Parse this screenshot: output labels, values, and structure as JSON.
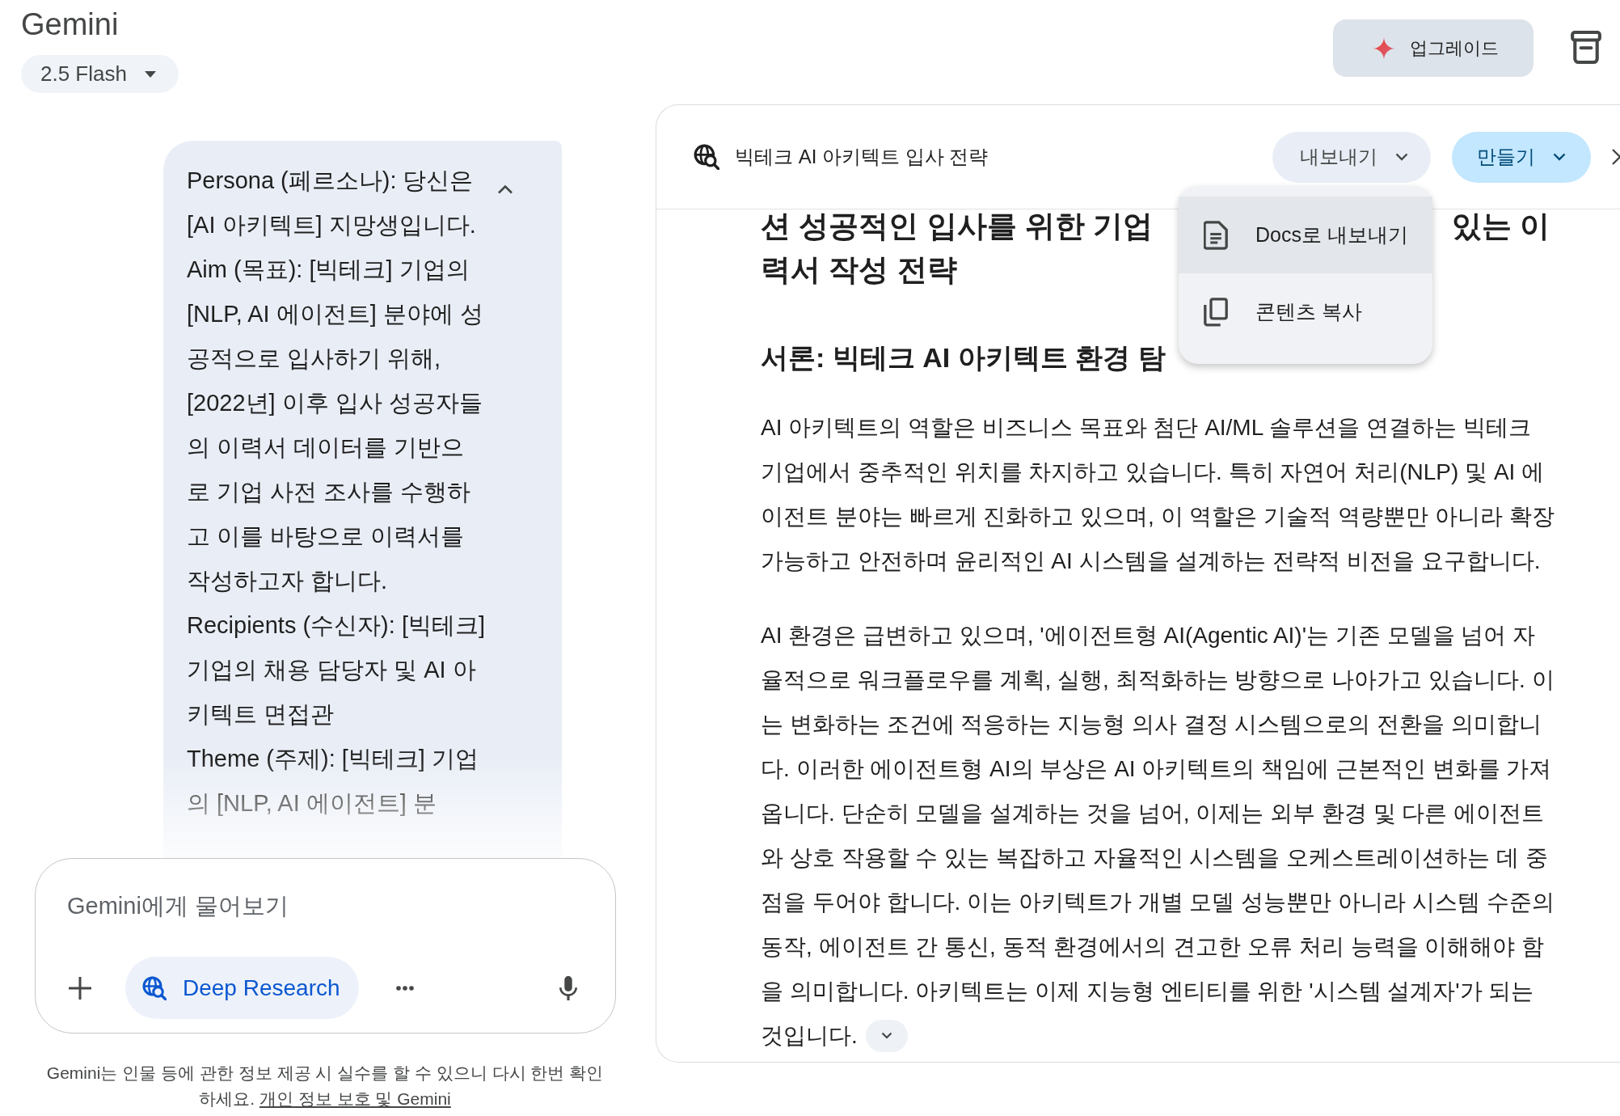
{
  "header": {
    "title": "Gemini",
    "model_picker": {
      "label": "2.5 Flash"
    }
  },
  "top_bar": {
    "upgrade_button": {
      "label": "업그레이드"
    }
  },
  "conversation": {
    "user_message": {
      "expanded": true,
      "paragraphs": [
        "Persona (페르소나): 당신은 [AI 아키텍트] 지망생입니다.",
        "Aim (목표): [빅테크] 기업의 [NLP, AI 에이전트] 분야에 성공적으로 입사하기 위해, [2022년] 이후 입사 성공자들의 이력서 데이터를 기반으로 기업 사전 조사를 수행하고 이를 바탕으로 이력서를 작성하고자 합니다.",
        "Recipients (수신자): [빅테크] 기업의 채용 담당자 및 AI 아키텍트 면접관",
        "Theme (주제): [빅테크] 기업의 [NLP, AI 에이전트] 분"
      ]
    }
  },
  "prompt": {
    "placeholder": "Gemini에게 물어보기",
    "tools": [
      {
        "kind": "add"
      },
      {
        "kind": "chip",
        "label": "Deep Research"
      },
      {
        "kind": "more"
      },
      {
        "kind": "mic"
      }
    ]
  },
  "disclaimer": {
    "text": "Gemini는 인물 등에 관한 정보 제공 시 실수를 할 수 있으니 다시 한번 확인하세요.",
    "link": "개인 정보 보호 및 Gemini"
  },
  "document": {
    "title": "빅테크 AI 아키텍트 입사 전략",
    "actions": [
      {
        "kind": "secondary",
        "label": "내보내기"
      },
      {
        "kind": "primary",
        "label": "만들기"
      }
    ],
    "export_menu": {
      "items": [
        {
          "kind": "doc",
          "label": "Docs로 내보내기",
          "highlighted": true
        },
        {
          "kind": "copy",
          "label": "콘텐츠 복사",
          "highlighted": false
        }
      ]
    },
    "body": [
      {
        "kind": "title",
        "lines": [
          {
            "left": "션 성공적인 입사를 위한 기업",
            "right": "있는 이"
          },
          {
            "left": "력서 작성 전략"
          }
        ]
      },
      {
        "kind": "section_heading",
        "text": "서론: 빅테크 AI 아키텍트 환경 탐"
      },
      {
        "kind": "paragraph",
        "text": "AI 아키텍트의 역할은 비즈니스 목표와 첨단 AI/ML 솔루션을 연결하는 빅테크 기업에서 중추적인 위치를 차지하고 있습니다. 특히 자연어 처리(NLP) 및 AI 에이전트 분야는 빠르게 진화하고 있으며, 이 역할은 기술적 역량뿐만 아니라 확장 가능하고 안전하며 윤리적인 AI 시스템을 설계하는 전략적 비전을 요구합니다."
      },
      {
        "kind": "paragraph",
        "text": "AI 환경은 급변하고 있으며, '에이전트형 AI(Agentic AI)'는 기존 모델을 넘어 자율적으로 워크플로우를 계획, 실행, 최적화하는 방향으로 나아가고 있습니다. 이는 변화하는 조건에 적응하는 지능형 의사 결정 시스템으로의 전환을 의미합니다. 이러한 에이전트형 AI의 부상은 AI 아키텍트의 책임에 근본적인 변화를 가져옵니다. 단순히 모델을 설계하는 것을 넘어, 이제는 외부 환경 및 다른 에이전트와 상호 작용할 수 있는 복잡하고 자율적인 시스템을 오케스트레이션하는 데 중점을 두어야 합니다. 이는 아키텍트가 개별 모델 성능뿐만 아니라 시스템 수준의 동작, 에이전트 간 통신, 동적 환경에서의 견고한 오류 처리 능력을 이해해야 함을 의미합니다. 아키텍트는 이제 지능형 엔티티를 위한 '시스템 설계자'가 되는 것입니다."
      }
    ]
  }
}
